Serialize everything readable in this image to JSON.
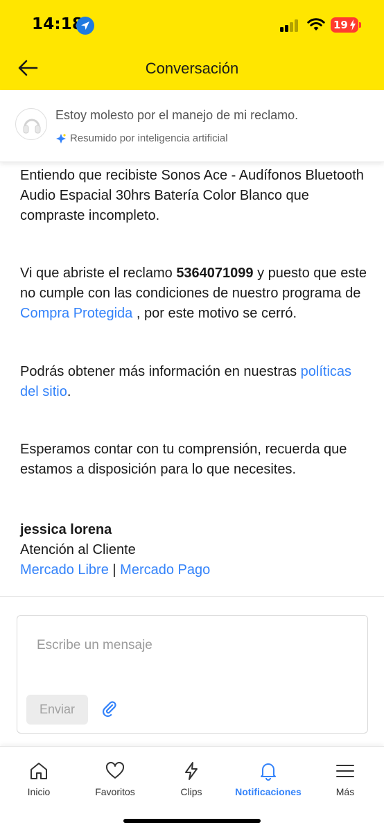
{
  "status_bar": {
    "time": "14:18",
    "battery": "19"
  },
  "header": {
    "title": "Conversación",
    "bg_color": "#ffe600"
  },
  "summary": {
    "text": "Estoy molesto por el manejo de mi reclamo.",
    "ai_label": "Resumido por inteligencia artificial"
  },
  "message": {
    "p1": "Entiendo que recibiste Sonos Ace - Audífonos Bluetooth Audio Espacial 30hrs Batería Color Blanco que compraste incompleto.",
    "p2_before": "Vi que abriste el reclamo ",
    "claim_number": "5364071099",
    "p2_middle": " y puesto que este no cumple con las condiciones de nuestro programa de ",
    "p2_link": "Compra Protegida",
    "p2_after": " , por este motivo se cerró.",
    "p3_before": "Podrás obtener más información en nuestras ",
    "p3_link": "políticas del sitio",
    "p3_after": ".",
    "p4": "Esperamos contar con tu comprensión, recuerda que estamos a disposición para lo que necesites.",
    "signature_name": "jessica lorena",
    "signature_role": "Atención al Cliente",
    "signature_link1": "Mercado Libre",
    "signature_sep": " | ",
    "signature_link2": "Mercado Pago",
    "link_color": "#3483fa"
  },
  "composer": {
    "placeholder": "Escribe un mensaje",
    "send_label": "Enviar"
  },
  "bottom_nav": {
    "items": [
      {
        "label": "Inicio",
        "icon": "home-icon"
      },
      {
        "label": "Favoritos",
        "icon": "heart-icon"
      },
      {
        "label": "Clips",
        "icon": "lightning-icon"
      },
      {
        "label": "Notificaciones",
        "icon": "bell-icon",
        "active": true
      },
      {
        "label": "Más",
        "icon": "menu-icon"
      }
    ]
  }
}
